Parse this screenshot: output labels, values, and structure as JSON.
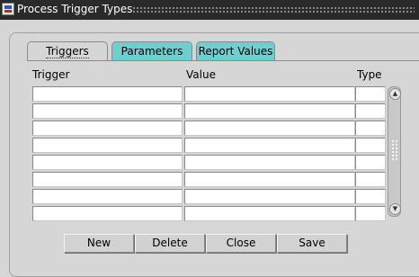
{
  "window": {
    "title": "Process Trigger Types"
  },
  "tabs": [
    {
      "label": "Triggers",
      "active": true
    },
    {
      "label": "Parameters",
      "active": false
    },
    {
      "label": "Report Values",
      "active": false
    }
  ],
  "columns": {
    "trigger": "Trigger",
    "value": "Value",
    "type": "Type"
  },
  "rows": [
    {
      "trigger": "",
      "value": "",
      "type": ""
    },
    {
      "trigger": "",
      "value": "",
      "type": ""
    },
    {
      "trigger": "",
      "value": "",
      "type": ""
    },
    {
      "trigger": "",
      "value": "",
      "type": ""
    },
    {
      "trigger": "",
      "value": "",
      "type": ""
    },
    {
      "trigger": "",
      "value": "",
      "type": ""
    },
    {
      "trigger": "",
      "value": "",
      "type": ""
    },
    {
      "trigger": "",
      "value": "",
      "type": ""
    }
  ],
  "buttons": {
    "new": "New",
    "delete": "Delete",
    "close": "Close",
    "save": "Save"
  },
  "scrollbar": {
    "up_icon": "arrow-up-icon",
    "down_icon": "arrow-down-icon"
  },
  "colors": {
    "tab_inactive": "#6fcfcf",
    "background": "#d6d6d6",
    "titlebar": "#2a2a2a"
  }
}
